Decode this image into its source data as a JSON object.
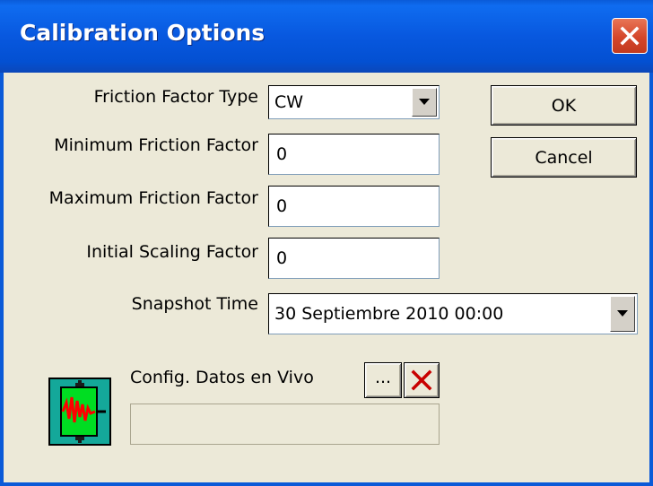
{
  "window": {
    "title": "Calibration Options"
  },
  "form": {
    "friction_factor_type": {
      "label": "Friction Factor Type",
      "value": "CW"
    },
    "min_friction_factor": {
      "label": "Minimum Friction Factor",
      "value": "0"
    },
    "max_friction_factor": {
      "label": "Maximum Friction Factor",
      "value": "0"
    },
    "initial_scaling_factor": {
      "label": "Initial Scaling Factor",
      "value": "0"
    },
    "snapshot_time": {
      "label": "Snapshot Time",
      "value": "30 Septiembre 2010  00:00"
    }
  },
  "buttons": {
    "ok": "OK",
    "cancel": "Cancel",
    "browse": "...",
    "clear_icon": "red-x-icon"
  },
  "live_data": {
    "label": "Config. Datos en Vivo",
    "value": "",
    "icon": "live-data-monitor-icon"
  },
  "colors": {
    "titlebar": "#0858df",
    "dialog_bg": "#ece9d8",
    "close_button": "#d4462a",
    "icon_bg": "#14a89a",
    "icon_green": "#00dd22",
    "icon_red": "#ff0000"
  }
}
